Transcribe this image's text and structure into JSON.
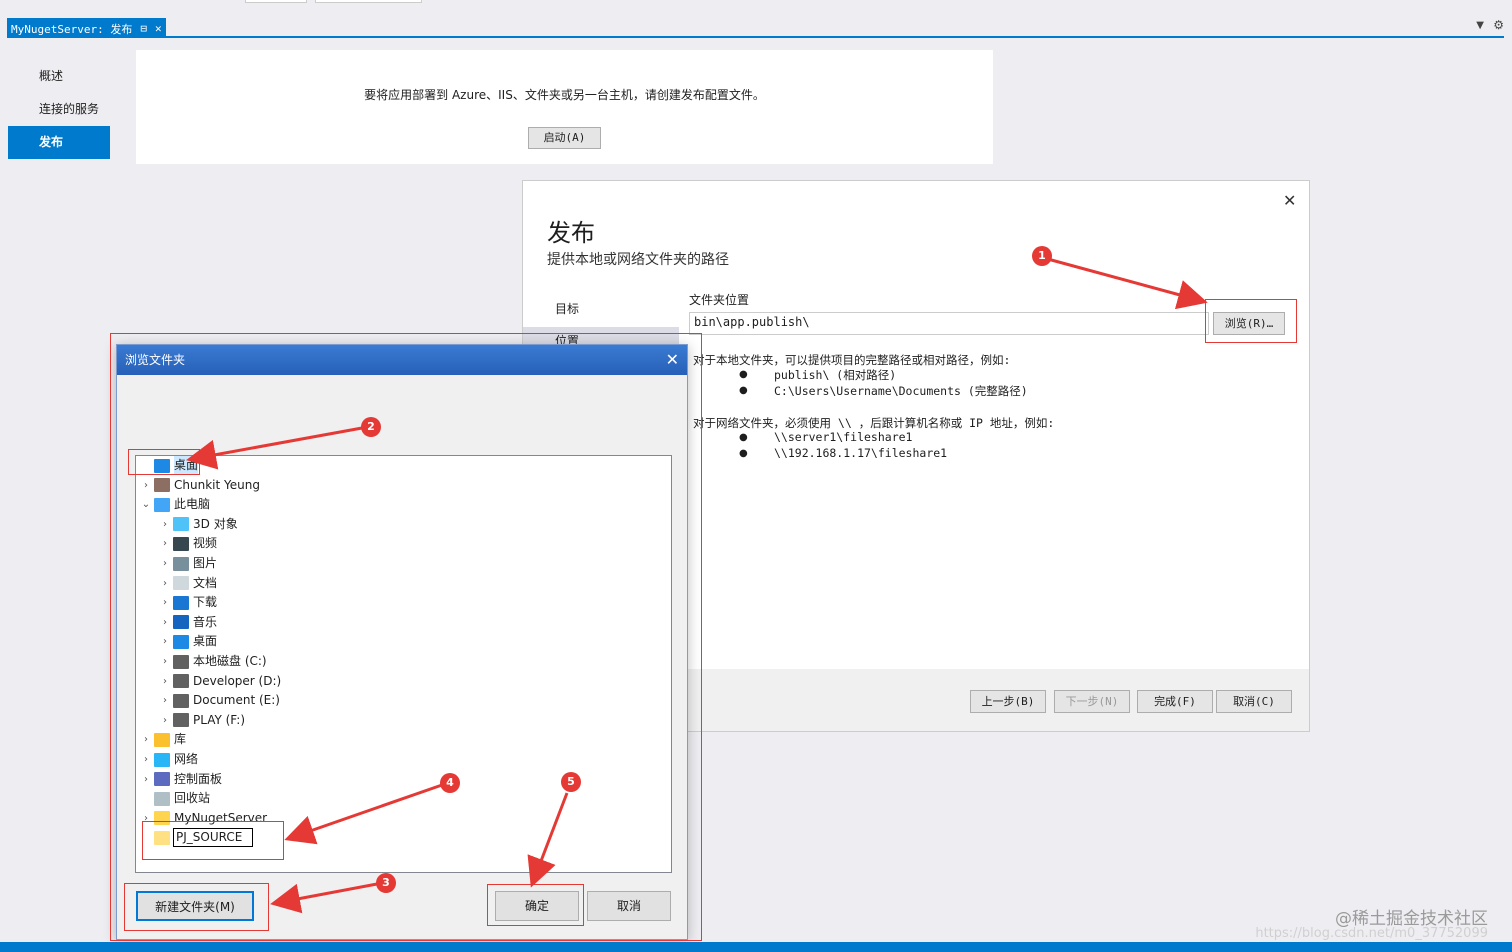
{
  "tab": {
    "title": "MyNugetServer: 发布",
    "pin": "⊟",
    "close": "✕"
  },
  "left_nav": {
    "items": [
      "概述",
      "连接的服务",
      "发布"
    ]
  },
  "card": {
    "message": "要将应用部署到 Azure、IIS、文件夹或另一台主机，请创建发布配置文件。",
    "start_button": "启动(A)"
  },
  "wizard": {
    "title": "发布",
    "subtitle": "提供本地或网络文件夹的路径",
    "nav": [
      "目标",
      "位置"
    ],
    "folder_label": "文件夹位置",
    "folder_value": "bin\\app.publish\\",
    "browse_button": "浏览(R)…",
    "hint_local": "对于本地文件夹，可以提供项目的完整路径或相对路径，例如:",
    "hint_local_items": [
      "publish\\ (相对路径)",
      "C:\\Users\\Username\\Documents (完整路径)"
    ],
    "hint_network": "对于网络文件夹，必须使用 \\\\ ，后跟计算机名称或 IP 地址，例如:",
    "hint_network_items": [
      "\\\\server1\\fileshare1",
      "\\\\192.168.1.17\\fileshare1"
    ],
    "buttons": {
      "prev": "上一步(B)",
      "next": "下一步(N)",
      "finish": "完成(F)",
      "cancel": "取消(C)"
    },
    "close": "✕"
  },
  "browse_dialog": {
    "title": "浏览文件夹",
    "close": "✕",
    "tree": [
      {
        "label": "桌面",
        "level": 0,
        "chevron": "",
        "icon": "desktop-icon"
      },
      {
        "label": "Chunkit Yeung",
        "level": 0,
        "chevron": ">",
        "icon": "user-icon"
      },
      {
        "label": "此电脑",
        "level": 0,
        "chevron": "v",
        "icon": "computer-icon"
      },
      {
        "label": "3D 对象",
        "level": 1,
        "chevron": ">",
        "icon": "3d-objects-icon"
      },
      {
        "label": "视频",
        "level": 1,
        "chevron": ">",
        "icon": "video-icon"
      },
      {
        "label": "图片",
        "level": 1,
        "chevron": ">",
        "icon": "pictures-icon"
      },
      {
        "label": "文档",
        "level": 1,
        "chevron": ">",
        "icon": "documents-icon"
      },
      {
        "label": "下载",
        "level": 1,
        "chevron": ">",
        "icon": "download-icon"
      },
      {
        "label": "音乐",
        "level": 1,
        "chevron": ">",
        "icon": "music-icon"
      },
      {
        "label": "桌面",
        "level": 1,
        "chevron": ">",
        "icon": "desktop-icon"
      },
      {
        "label": "本地磁盘 (C:)",
        "level": 1,
        "chevron": ">",
        "icon": "drive-icon"
      },
      {
        "label": "Developer (D:)",
        "level": 1,
        "chevron": ">",
        "icon": "drive-icon"
      },
      {
        "label": "Document (E:)",
        "level": 1,
        "chevron": ">",
        "icon": "drive-icon"
      },
      {
        "label": "PLAY (F:)",
        "level": 1,
        "chevron": ">",
        "icon": "drive-icon"
      },
      {
        "label": "库",
        "level": 0,
        "chevron": ">",
        "icon": "library-icon"
      },
      {
        "label": "网络",
        "level": 0,
        "chevron": ">",
        "icon": "network-icon"
      },
      {
        "label": "控制面板",
        "level": 0,
        "chevron": ">",
        "icon": "control-panel-icon"
      },
      {
        "label": "回收站",
        "level": 0,
        "chevron": "",
        "icon": "recycle-bin-icon"
      },
      {
        "label": "MyNugetServer",
        "level": 0,
        "chevron": ">",
        "icon": "folder-icon"
      }
    ],
    "rename_value": "PJ_SOURCE",
    "new_folder_button": "新建文件夹(M)",
    "ok_button": "确定",
    "cancel_button": "取消"
  },
  "annotations": [
    "1",
    "2",
    "3",
    "4",
    "5"
  ],
  "watermark": "@稀土掘金技术社区",
  "watermark_url": "https://blog.csdn.net/m0_37752099",
  "colors": {
    "accent": "#007acc",
    "annotation": "#e53935",
    "dialog_title": "#2b6cc4"
  }
}
